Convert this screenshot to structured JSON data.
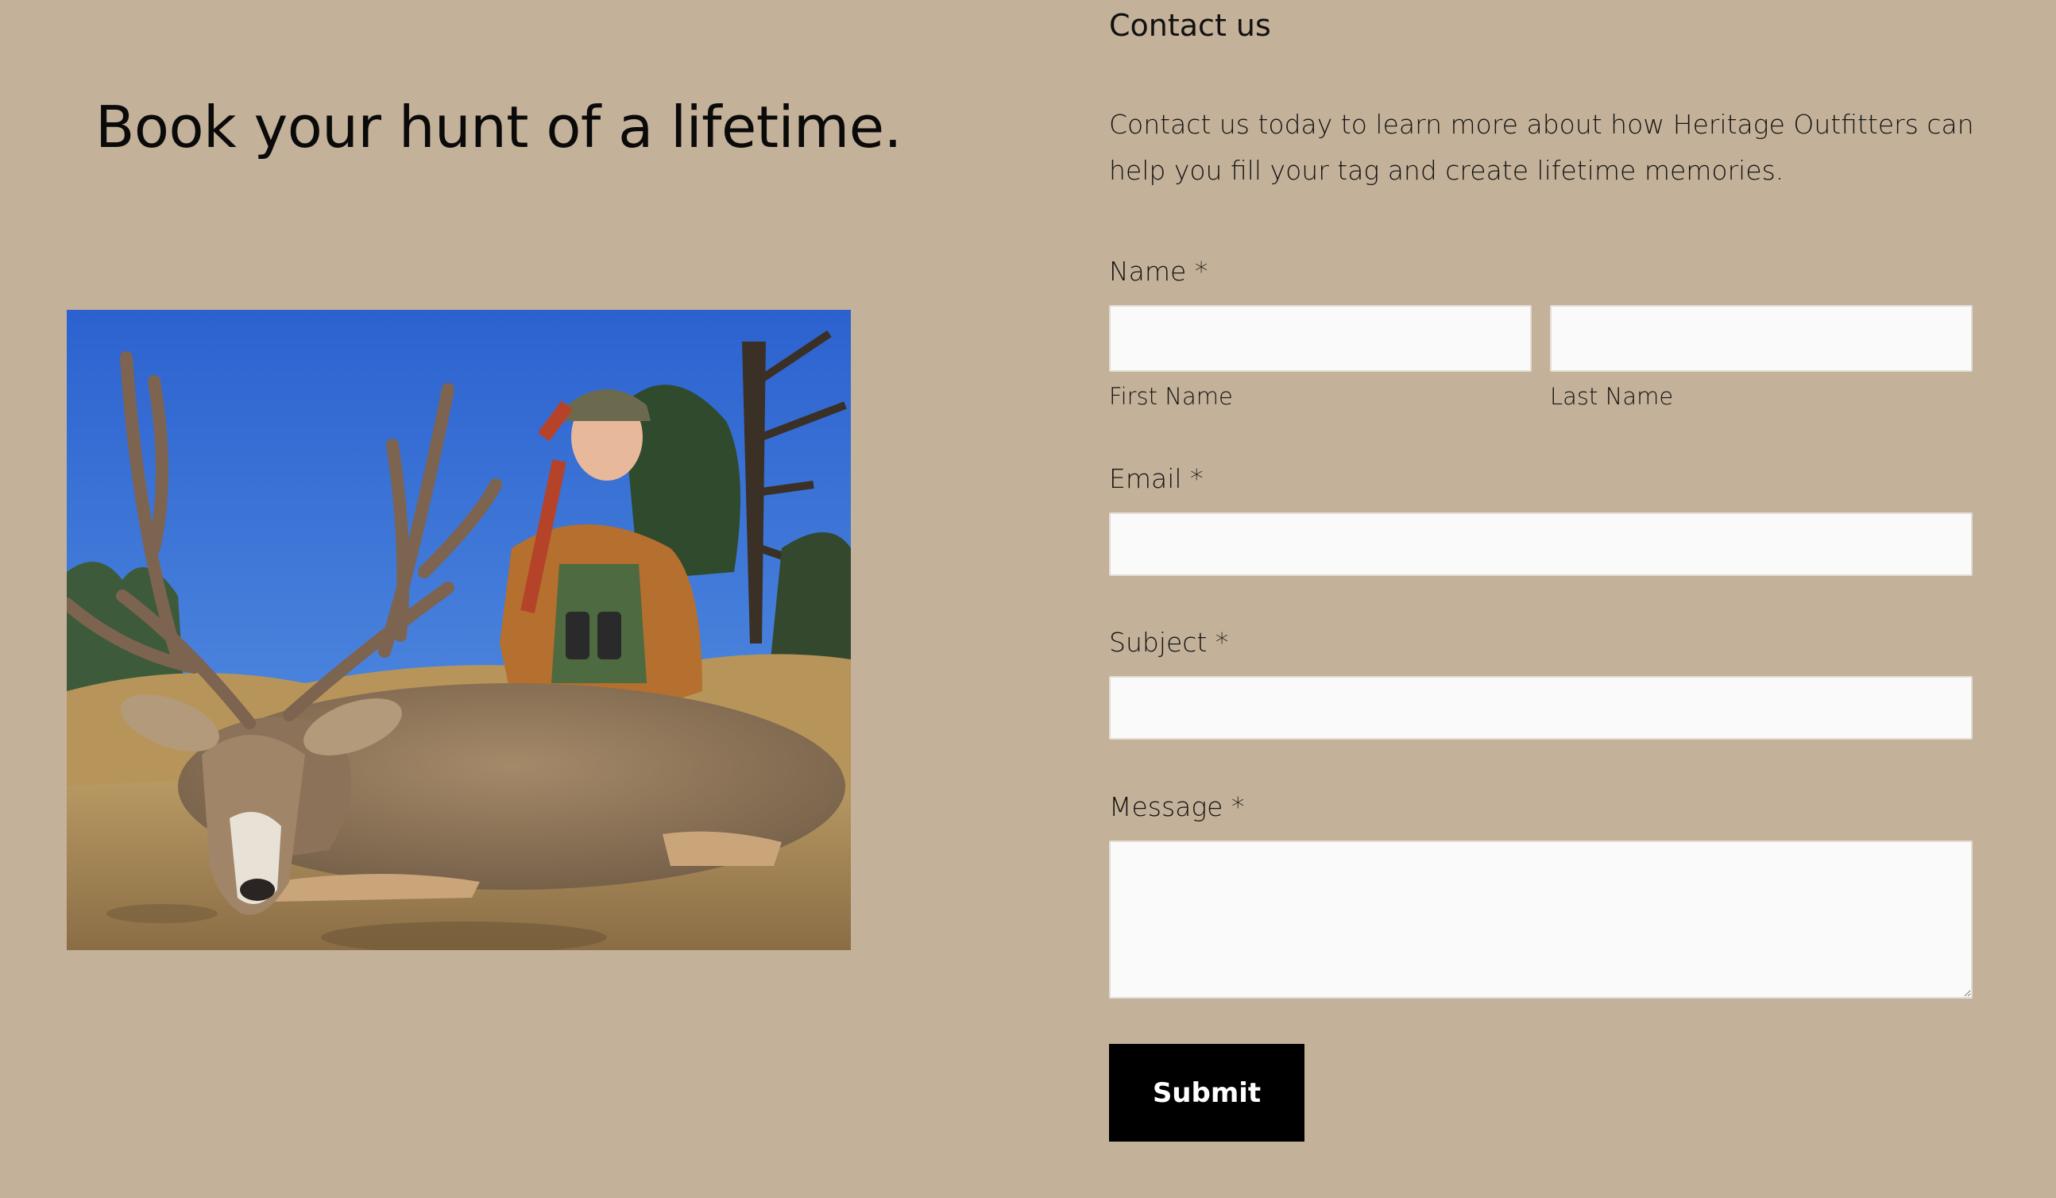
{
  "hero": {
    "headline": "Book your hunt of a lifetime.",
    "photo_alt": "Hunter kneeling behind a mule deer buck"
  },
  "contact": {
    "title": "Contact us",
    "intro": "Contact us today to learn more about how Heritage Outfitters can help you fill your tag and create lifetime memories.",
    "name_label": "Name *",
    "first_name_label": "First Name",
    "first_name_value": "",
    "last_name_label": "Last Name",
    "last_name_value": "",
    "email_label": "Email *",
    "email_value": "",
    "subject_label": "Subject *",
    "subject_value": "",
    "message_label": "Message *",
    "message_value": "",
    "submit_label": "Submit"
  },
  "colors": {
    "page_background": "#c4b199",
    "input_background": "#fafafa",
    "button_background": "#000000",
    "button_text": "#ffffff"
  }
}
